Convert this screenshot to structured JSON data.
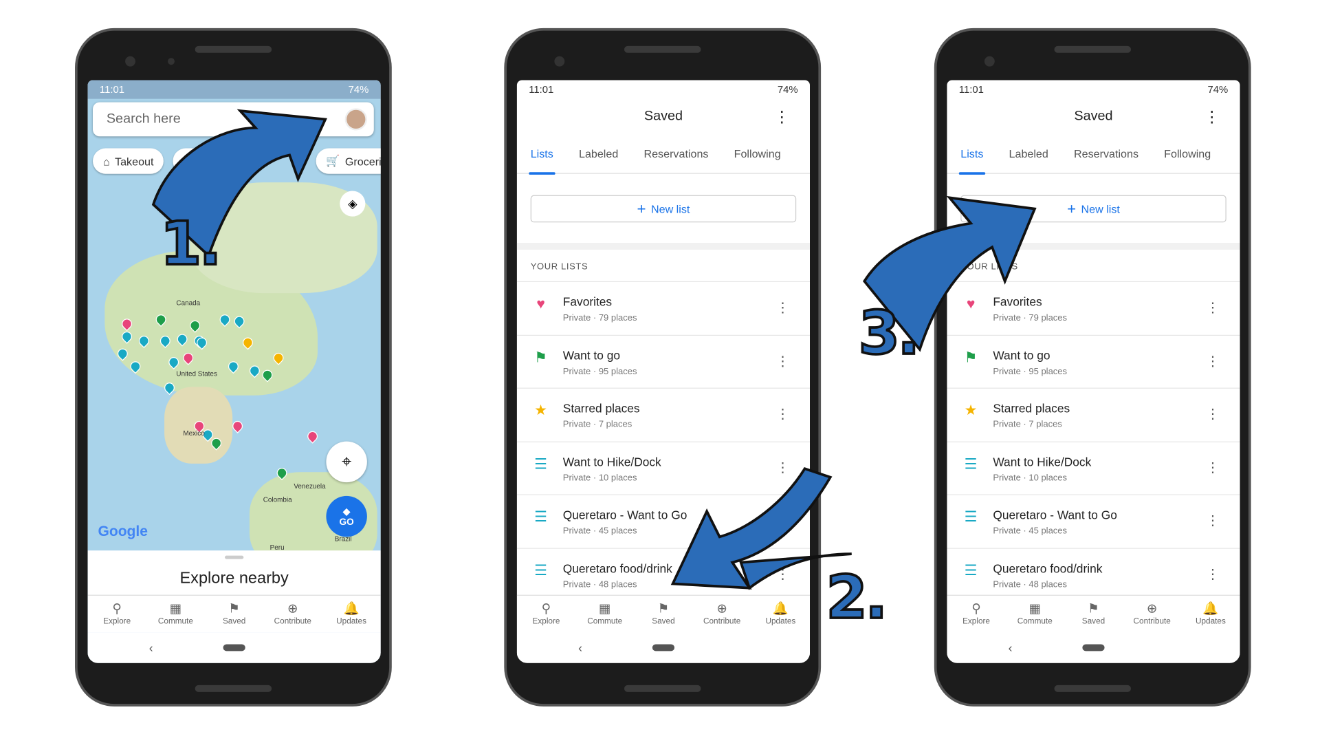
{
  "status_bar": {
    "time": "11:01",
    "battery": "74%"
  },
  "explore_screen": {
    "search_placeholder": "Search here",
    "chips": [
      "Takeout",
      "Groceries"
    ],
    "map_labels": [
      "Canada",
      "United States",
      "Mexico",
      "Venezuela",
      "Colombia",
      "Peru",
      "Brazil"
    ],
    "logo": "Google",
    "go_label": "GO",
    "sheet_title": "Explore nearby"
  },
  "nav": [
    {
      "label": "Explore",
      "icon": "pin-icon"
    },
    {
      "label": "Commute",
      "icon": "commute-icon"
    },
    {
      "label": "Saved",
      "icon": "bookmark-icon"
    },
    {
      "label": "Contribute",
      "icon": "plus-circle-icon"
    },
    {
      "label": "Updates",
      "icon": "bell-icon"
    }
  ],
  "saved_screen": {
    "title": "Saved",
    "tabs": [
      "Lists",
      "Labeled",
      "Reservations",
      "Following"
    ],
    "new_list": "New list",
    "section": "YOUR LISTS",
    "lists": [
      {
        "name": "Favorites",
        "sub": "Private · 79 places",
        "icon": "heart-icon",
        "color": "#e8457a"
      },
      {
        "name": "Want to go",
        "sub": "Private · 95 places",
        "icon": "flag-icon",
        "color": "#1e9e4a"
      },
      {
        "name": "Starred places",
        "sub": "Private · 7 places",
        "icon": "star-icon",
        "color": "#f5b400"
      },
      {
        "name": "Want to Hike/Dock",
        "sub": "Private · 10 places",
        "icon": "list-icon",
        "color": "#19a9c4"
      },
      {
        "name": "Queretaro - Want to Go",
        "sub": "Private · 45 places",
        "icon": "list-icon",
        "color": "#19a9c4"
      },
      {
        "name": "Queretaro food/drink",
        "sub": "Private · 48 places",
        "icon": "list-icon",
        "color": "#19a9c4"
      }
    ]
  },
  "annotations": [
    "1.",
    "2.",
    "3."
  ],
  "colors": {
    "accent": "#1a73e8",
    "arrow": "#2b6cb8"
  }
}
